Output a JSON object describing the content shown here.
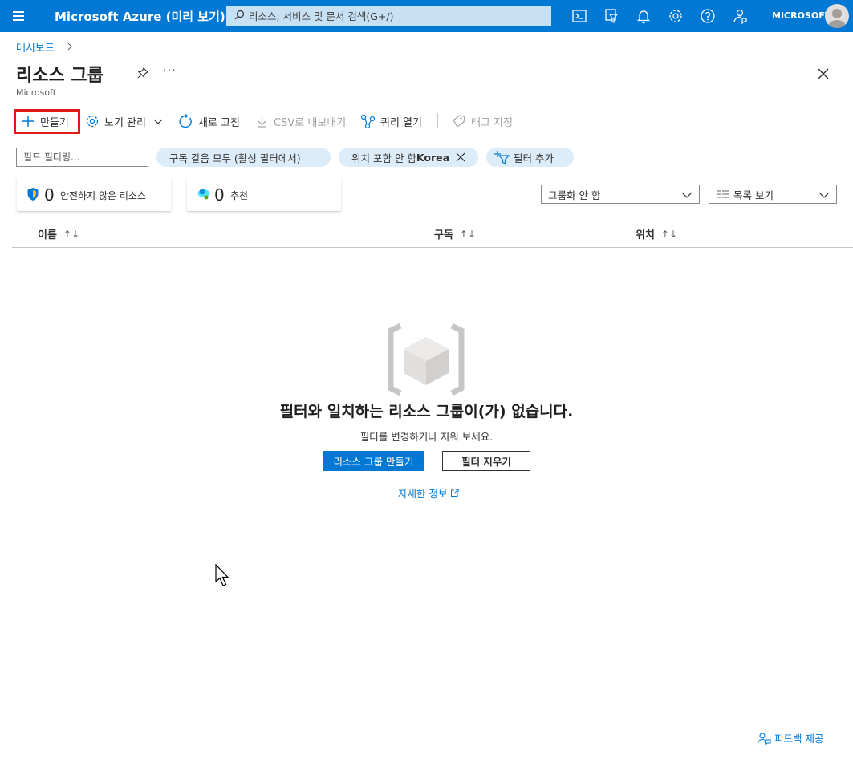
{
  "topbar": {
    "brand": "Microsoft Azure (미리 보기)",
    "search_placeholder": "리소스, 서비스 및 문서 검색(G+/)",
    "account": "MICROSOFT",
    "icons": [
      "cloud-shell-icon",
      "directory-filter-icon",
      "notifications-icon",
      "settings-icon",
      "help-icon",
      "feedback-icon"
    ]
  },
  "breadcrumb": {
    "dashboard": "대시보드"
  },
  "header": {
    "title": "리소스 그룹",
    "subtitle": "Microsoft",
    "more": "···"
  },
  "commands": {
    "create": "만들기",
    "manage_view": "보기 관리",
    "refresh": "새로 고침",
    "export_csv": "CSV로 내보내기",
    "open_query": "쿼리 열기",
    "assign_tags": "태그 지정"
  },
  "filters": {
    "field_placeholder": "필드 필터링...",
    "subscription_pill": "구독 같음 모두 (활성 필터에서)",
    "location_prefix": "위치 포함 안 함 ",
    "location_value": "Korea",
    "add_filter": "필터 추가"
  },
  "summary": {
    "insecure_count": "0",
    "insecure_label": "안전하지 않은 리소스",
    "recommend_count": "0",
    "recommend_label": "추천"
  },
  "grouping": {
    "value": "그룹화 안 함"
  },
  "view": {
    "value": "목록 보기"
  },
  "table": {
    "columns": [
      {
        "label": "이름",
        "sort": "↑↓"
      },
      {
        "label": "구독",
        "sort": "↑↓"
      },
      {
        "label": "위치",
        "sort": "↑↓"
      }
    ]
  },
  "empty_state": {
    "title": "필터와 일치하는 리소스 그룹이(가) 없습니다.",
    "subtitle": "필터를 변경하거나 지워 보세요.",
    "create_button": "리소스 그룹 만들기",
    "clear_button": "필터 지우기",
    "learn_more": "자세한 정보"
  },
  "footer": {
    "feedback": "피드백 제공"
  },
  "colors": {
    "accent": "#0078d4",
    "highlight_box": "#e31919",
    "pill_bg": "#ddecf9"
  }
}
